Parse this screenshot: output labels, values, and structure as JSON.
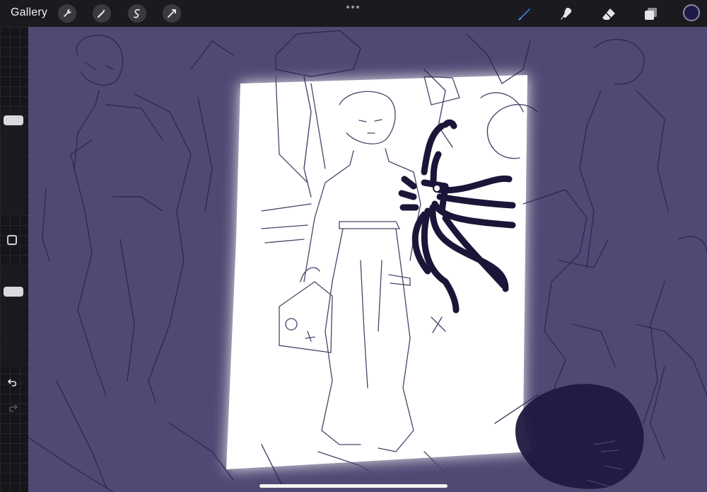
{
  "topbar": {
    "gallery_label": "Gallery",
    "left_tools": [
      "wrench-icon",
      "magic-wand-icon",
      "selection-icon",
      "transform-icon"
    ],
    "more_icon": "ellipsis-icon",
    "right_tools": [
      "brush-icon",
      "smudge-icon",
      "eraser-icon",
      "layers-icon"
    ],
    "active_tool": "brush",
    "current_color": "#1d1a4a",
    "accent_color": "#3f8cff"
  },
  "sidebar": {
    "brush_size_slider": "slider",
    "opacity_slider": "slider",
    "modify_button": "square-icon",
    "undo": "undo-icon",
    "redo": "redo-icon"
  },
  "canvas": {
    "background_color": "#4f4a74",
    "lit_area_color": "#ffffff",
    "ink_color": "#1a1638"
  }
}
